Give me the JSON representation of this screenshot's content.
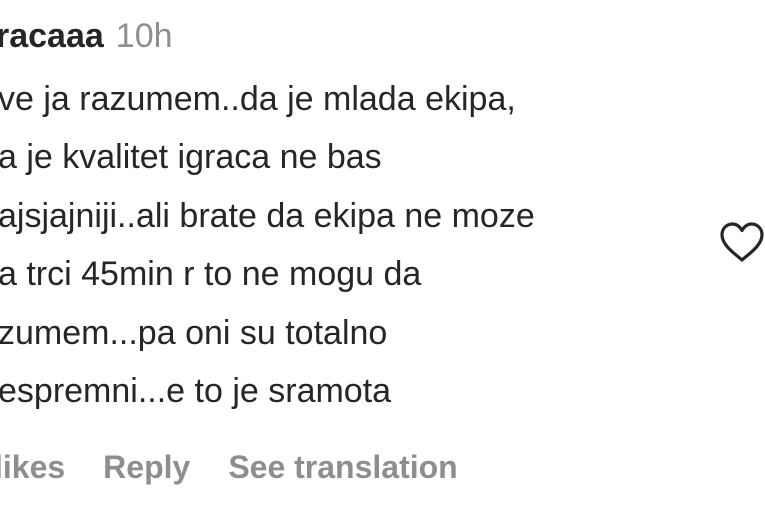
{
  "comment": {
    "username": "racaaa",
    "timestamp": "10h",
    "lines": [
      "ve ja razumem..da je mlada ekipa,",
      "a je kvalitet igraca ne bas",
      "ajsjajniji..ali brate da ekipa ne moze",
      "a trci 45min r to ne mogu da",
      "zumem...pa oni su totalno",
      "espremni...e to je sramota"
    ],
    "actions": {
      "likes": "likes",
      "reply": "Reply",
      "translation": "See translation"
    },
    "like_icon": "heart-outline-icon"
  },
  "colors": {
    "text": "#262626",
    "muted": "#8e8e8e",
    "background": "#ffffff"
  }
}
